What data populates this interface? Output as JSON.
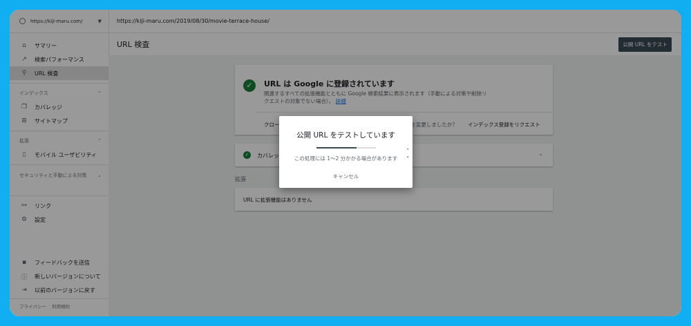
{
  "property": "https://kiji-maru.com/",
  "url_bar": "https://kiji-maru.com/2019/08/30/movie-terrace-house/",
  "header": {
    "title": "URL 検査",
    "test_button": "公開 URL をテスト"
  },
  "sidebar": {
    "items": [
      {
        "label": "サマリー",
        "icon": "home-icon"
      },
      {
        "label": "検索パフォーマンス",
        "icon": "trend-icon"
      },
      {
        "label": "URL 検査",
        "icon": "search-icon"
      }
    ],
    "index_section": "インデックス",
    "index_items": [
      {
        "label": "カバレッジ",
        "icon": "copy-icon"
      },
      {
        "label": "サイトマップ",
        "icon": "sitemap-icon"
      }
    ],
    "enhance_section": "拡張",
    "enhance_items": [
      {
        "label": "モバイル ユーザビリティ",
        "icon": "phone-icon"
      }
    ],
    "security_section": "セキュリティと手動による対策",
    "other_items": [
      {
        "label": "リンク",
        "icon": "link-icon"
      },
      {
        "label": "設定",
        "icon": "gear-icon"
      }
    ],
    "bottom_items": [
      {
        "label": "フィードバックを送信",
        "icon": "feedback-icon"
      },
      {
        "label": "新しいバージョンについて",
        "icon": "info-icon"
      },
      {
        "label": "以前のバージョンに戻す",
        "icon": "exit-icon"
      }
    ],
    "footer": {
      "privacy": "プライバシー",
      "terms": "利用規約"
    }
  },
  "status_card": {
    "title": "URL は Google に登録されています",
    "description": "関連するすべての拡張機能とともに Google 検索結果に表示されます（手動による対策や削除リクエストの対象でない場合）。",
    "details_link": "詳細",
    "crawl_link": "クロール済みのページを表示",
    "changed_text": "ページを変更しましたか？",
    "request_index": "インデックス登録をリクエスト"
  },
  "coverage_card": {
    "label": "カバレッジ"
  },
  "enhancements": {
    "label": "拡張",
    "empty": "URL に拡張機能はありません"
  },
  "dialog": {
    "title": "公開 URL をテストしています",
    "note": "この処理には 1〜2 分かかる場合があります",
    "cancel": "キャンセル",
    "progress": 0.68
  }
}
